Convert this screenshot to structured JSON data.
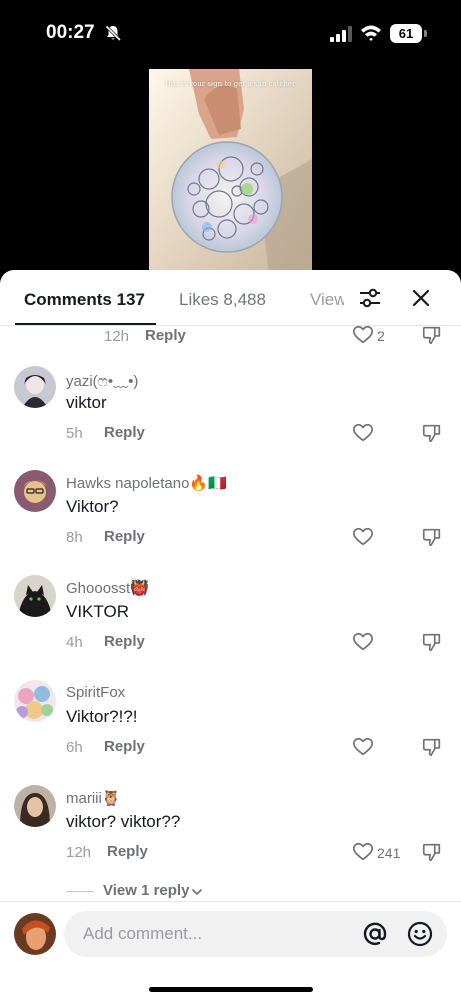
{
  "status_bar": {
    "time": "00:27",
    "battery": "61"
  },
  "video": {
    "caption": "this is your sign to get a sun catcher"
  },
  "tabs": {
    "comments": "Comments 137",
    "likes": "Likes 8,488",
    "views": "Views"
  },
  "partial_comment": {
    "time": "12h",
    "reply": "Reply",
    "likes": "2"
  },
  "comments": [
    {
      "username": "yazi(ෆ•﹏•)",
      "text": "viktor",
      "time": "5h",
      "reply": "Reply",
      "likes": ""
    },
    {
      "username": "Hawks napoletano🔥🇮🇹",
      "text": "Viktor?",
      "time": "8h",
      "reply": "Reply",
      "likes": ""
    },
    {
      "username": "Ghooosst👹",
      "text": "VIKTOR",
      "time": "4h",
      "reply": "Reply",
      "likes": ""
    },
    {
      "username": "SpiritFox",
      "text": "Viktor?!?!",
      "time": "6h",
      "reply": "Reply",
      "likes": ""
    },
    {
      "username": "mariii🦉",
      "text": "viktor? viktor??",
      "time": "12h",
      "reply": "Reply",
      "likes": "241"
    }
  ],
  "view_replies": "View 1 reply",
  "input": {
    "placeholder": "Add comment..."
  },
  "icons": {
    "status": [
      "bell-slash-icon",
      "signal-icon",
      "wifi-icon",
      "battery-icon"
    ],
    "sheet": [
      "filter-icon",
      "close-icon",
      "heart-icon",
      "dislike-icon",
      "chevron-down-icon",
      "at-mention-icon",
      "emoji-icon"
    ]
  },
  "colors": {
    "text": "#161823",
    "secondary": "#6f7079",
    "muted": "#9a9ba2",
    "background": "#ffffff"
  }
}
